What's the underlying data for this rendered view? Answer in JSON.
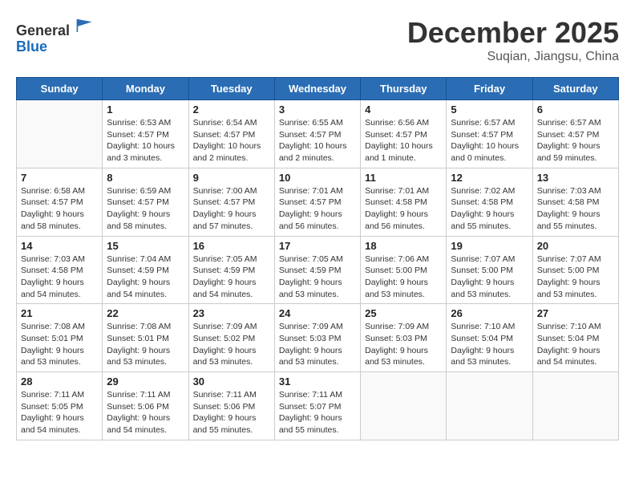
{
  "header": {
    "logo_line1": "General",
    "logo_line2": "Blue",
    "month_title": "December 2025",
    "subtitle": "Suqian, Jiangsu, China"
  },
  "days_of_week": [
    "Sunday",
    "Monday",
    "Tuesday",
    "Wednesday",
    "Thursday",
    "Friday",
    "Saturday"
  ],
  "weeks": [
    [
      {
        "day": "",
        "info": ""
      },
      {
        "day": "1",
        "info": "Sunrise: 6:53 AM\nSunset: 4:57 PM\nDaylight: 10 hours\nand 3 minutes."
      },
      {
        "day": "2",
        "info": "Sunrise: 6:54 AM\nSunset: 4:57 PM\nDaylight: 10 hours\nand 2 minutes."
      },
      {
        "day": "3",
        "info": "Sunrise: 6:55 AM\nSunset: 4:57 PM\nDaylight: 10 hours\nand 2 minutes."
      },
      {
        "day": "4",
        "info": "Sunrise: 6:56 AM\nSunset: 4:57 PM\nDaylight: 10 hours\nand 1 minute."
      },
      {
        "day": "5",
        "info": "Sunrise: 6:57 AM\nSunset: 4:57 PM\nDaylight: 10 hours\nand 0 minutes."
      },
      {
        "day": "6",
        "info": "Sunrise: 6:57 AM\nSunset: 4:57 PM\nDaylight: 9 hours\nand 59 minutes."
      }
    ],
    [
      {
        "day": "7",
        "info": "Sunrise: 6:58 AM\nSunset: 4:57 PM\nDaylight: 9 hours\nand 58 minutes."
      },
      {
        "day": "8",
        "info": "Sunrise: 6:59 AM\nSunset: 4:57 PM\nDaylight: 9 hours\nand 58 minutes."
      },
      {
        "day": "9",
        "info": "Sunrise: 7:00 AM\nSunset: 4:57 PM\nDaylight: 9 hours\nand 57 minutes."
      },
      {
        "day": "10",
        "info": "Sunrise: 7:01 AM\nSunset: 4:57 PM\nDaylight: 9 hours\nand 56 minutes."
      },
      {
        "day": "11",
        "info": "Sunrise: 7:01 AM\nSunset: 4:58 PM\nDaylight: 9 hours\nand 56 minutes."
      },
      {
        "day": "12",
        "info": "Sunrise: 7:02 AM\nSunset: 4:58 PM\nDaylight: 9 hours\nand 55 minutes."
      },
      {
        "day": "13",
        "info": "Sunrise: 7:03 AM\nSunset: 4:58 PM\nDaylight: 9 hours\nand 55 minutes."
      }
    ],
    [
      {
        "day": "14",
        "info": "Sunrise: 7:03 AM\nSunset: 4:58 PM\nDaylight: 9 hours\nand 54 minutes."
      },
      {
        "day": "15",
        "info": "Sunrise: 7:04 AM\nSunset: 4:59 PM\nDaylight: 9 hours\nand 54 minutes."
      },
      {
        "day": "16",
        "info": "Sunrise: 7:05 AM\nSunset: 4:59 PM\nDaylight: 9 hours\nand 54 minutes."
      },
      {
        "day": "17",
        "info": "Sunrise: 7:05 AM\nSunset: 4:59 PM\nDaylight: 9 hours\nand 53 minutes."
      },
      {
        "day": "18",
        "info": "Sunrise: 7:06 AM\nSunset: 5:00 PM\nDaylight: 9 hours\nand 53 minutes."
      },
      {
        "day": "19",
        "info": "Sunrise: 7:07 AM\nSunset: 5:00 PM\nDaylight: 9 hours\nand 53 minutes."
      },
      {
        "day": "20",
        "info": "Sunrise: 7:07 AM\nSunset: 5:00 PM\nDaylight: 9 hours\nand 53 minutes."
      }
    ],
    [
      {
        "day": "21",
        "info": "Sunrise: 7:08 AM\nSunset: 5:01 PM\nDaylight: 9 hours\nand 53 minutes."
      },
      {
        "day": "22",
        "info": "Sunrise: 7:08 AM\nSunset: 5:01 PM\nDaylight: 9 hours\nand 53 minutes."
      },
      {
        "day": "23",
        "info": "Sunrise: 7:09 AM\nSunset: 5:02 PM\nDaylight: 9 hours\nand 53 minutes."
      },
      {
        "day": "24",
        "info": "Sunrise: 7:09 AM\nSunset: 5:03 PM\nDaylight: 9 hours\nand 53 minutes."
      },
      {
        "day": "25",
        "info": "Sunrise: 7:09 AM\nSunset: 5:03 PM\nDaylight: 9 hours\nand 53 minutes."
      },
      {
        "day": "26",
        "info": "Sunrise: 7:10 AM\nSunset: 5:04 PM\nDaylight: 9 hours\nand 53 minutes."
      },
      {
        "day": "27",
        "info": "Sunrise: 7:10 AM\nSunset: 5:04 PM\nDaylight: 9 hours\nand 54 minutes."
      }
    ],
    [
      {
        "day": "28",
        "info": "Sunrise: 7:11 AM\nSunset: 5:05 PM\nDaylight: 9 hours\nand 54 minutes."
      },
      {
        "day": "29",
        "info": "Sunrise: 7:11 AM\nSunset: 5:06 PM\nDaylight: 9 hours\nand 54 minutes."
      },
      {
        "day": "30",
        "info": "Sunrise: 7:11 AM\nSunset: 5:06 PM\nDaylight: 9 hours\nand 55 minutes."
      },
      {
        "day": "31",
        "info": "Sunrise: 7:11 AM\nSunset: 5:07 PM\nDaylight: 9 hours\nand 55 minutes."
      },
      {
        "day": "",
        "info": ""
      },
      {
        "day": "",
        "info": ""
      },
      {
        "day": "",
        "info": ""
      }
    ]
  ]
}
